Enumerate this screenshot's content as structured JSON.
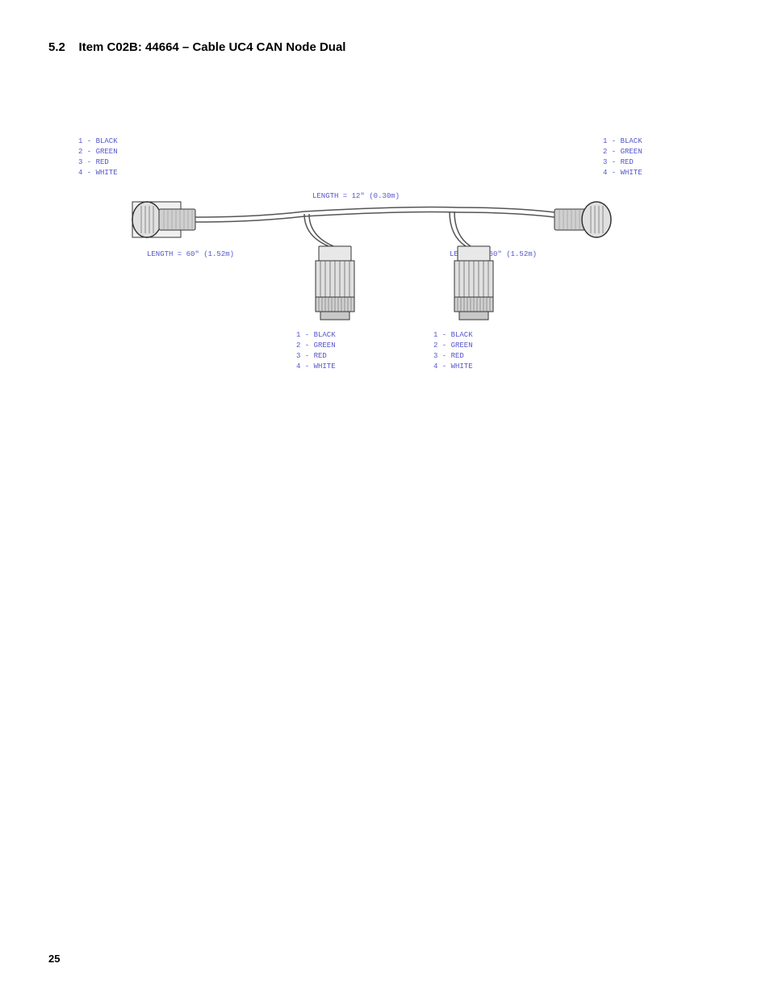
{
  "page": {
    "number": "25"
  },
  "section": {
    "number": "5.2",
    "title": "Item C02B: 44664 – Cable UC4 CAN Node Dual"
  },
  "diagram": {
    "length_top": "LENGTH = 12\" (0.30m)",
    "length_left": "LENGTH = 60\" (1.52m)",
    "length_right": "LENGTH = 60\" (1.52m)",
    "left_connector_labels": [
      "1 - BLACK",
      "2 - GREEN",
      "3 - RED",
      "4 - WHITE"
    ],
    "right_connector_labels": [
      "1 - BLACK",
      "2 - GREEN",
      "3 - RED",
      "4 - WHITE"
    ],
    "bottom_left_labels": [
      "1 - BLACK",
      "2 - GREEN",
      "3 - RED",
      "4 - WHITE"
    ],
    "bottom_right_labels": [
      "1 - BLACK",
      "2 - GREEN",
      "3 - RED",
      "4 - WHITE"
    ]
  }
}
